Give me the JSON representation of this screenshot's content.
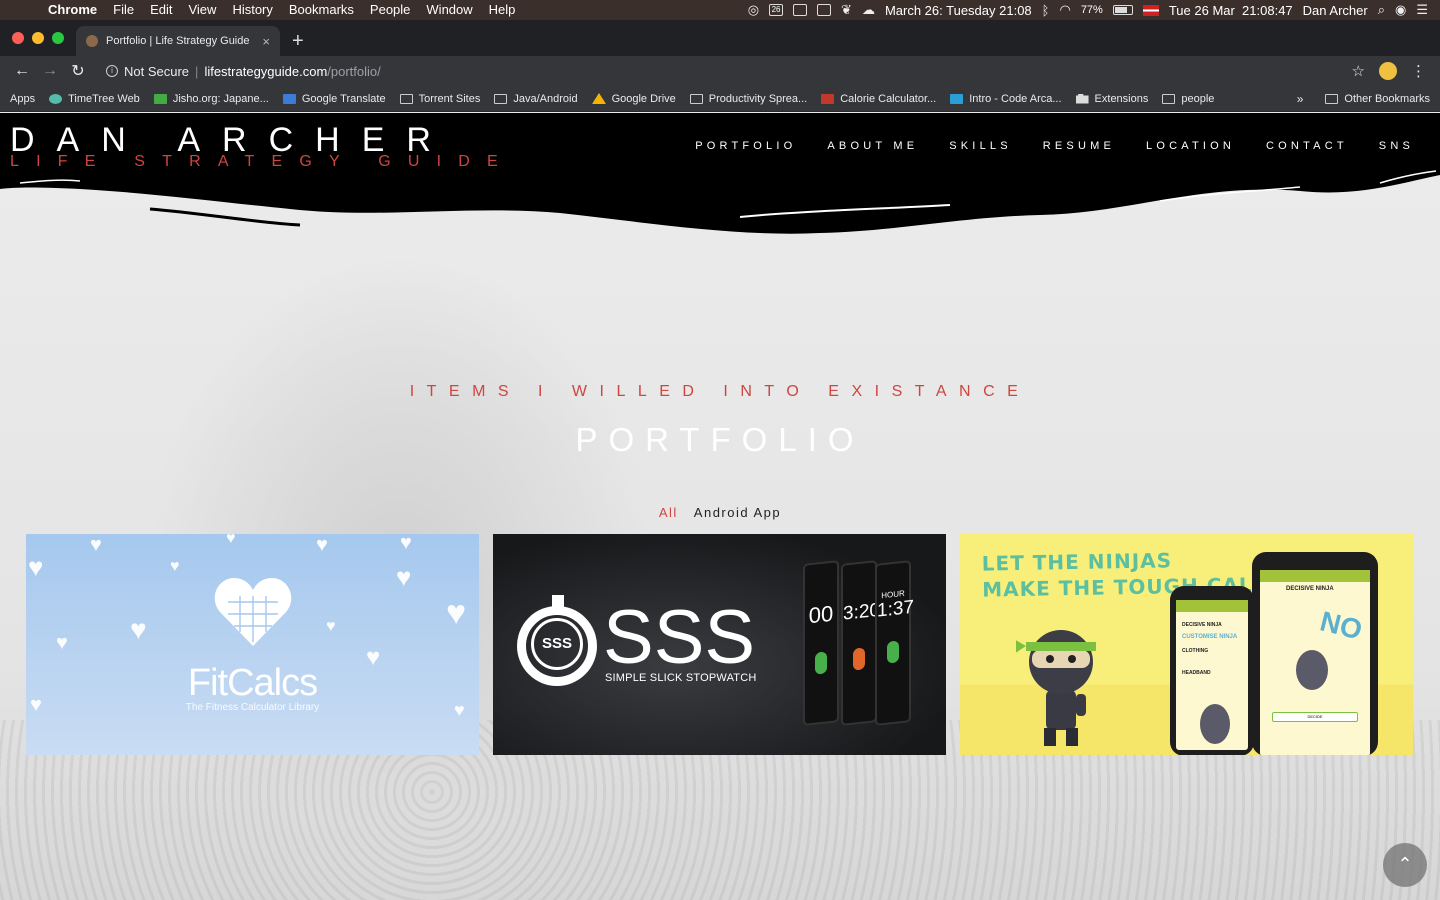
{
  "menubar": {
    "app": "Chrome",
    "items": [
      "File",
      "Edit",
      "View",
      "History",
      "Bookmarks",
      "People",
      "Window",
      "Help"
    ],
    "calendar_day": "26",
    "date_short": "March 26: Tuesday 21:08",
    "battery": "77%",
    "clock": "Tue 26 Mar  21:08:47",
    "user": "Dan Archer"
  },
  "tab": {
    "title": "Portfolio | Life Strategy Guide",
    "close": "×",
    "new_tab": "+"
  },
  "toolbar": {
    "security": "Not Secure",
    "host": "lifestrategyguide.com",
    "path": "/portfolio/"
  },
  "bookmarks": [
    {
      "label": "Apps",
      "icon": "apps-grid-icon"
    },
    {
      "label": "TimeTree Web",
      "icon": "timetree-icon"
    },
    {
      "label": "Jisho.org: Japane...",
      "icon": "jisho-icon"
    },
    {
      "label": "Google Translate",
      "icon": "translate-icon"
    },
    {
      "label": "Torrent Sites",
      "icon": "folder-icon"
    },
    {
      "label": "Java/Android",
      "icon": "folder-icon"
    },
    {
      "label": "Google Drive",
      "icon": "drive-icon"
    },
    {
      "label": "Productivity Sprea...",
      "icon": "folder-icon"
    },
    {
      "label": "Calorie Calculator...",
      "icon": "calorie-icon"
    },
    {
      "label": "Intro - Code Arca...",
      "icon": "codearcade-icon"
    },
    {
      "label": "Extensions",
      "icon": "puzzle-icon"
    },
    {
      "label": "people",
      "icon": "folder-icon"
    }
  ],
  "bookmarks_more": "»",
  "other_bookmarks": "Other Bookmarks",
  "site": {
    "logo_name": "DAN ARCHER",
    "logo_sub": "LIFE STRATEGY GUIDE",
    "nav": [
      "PORTFOLIO",
      "ABOUT ME",
      "SKILLS",
      "RESUME",
      "LOCATION",
      "CONTACT",
      "SNS"
    ],
    "eyebrow": "ITEMS I WILLED INTO EXISTANCE",
    "title": "PORTFOLIO",
    "filters": {
      "all": "All",
      "android": "Android App"
    },
    "cards": {
      "fitcalcs": {
        "title": "FitCalcs",
        "subtitle": "The Fitness Calculator Library"
      },
      "sss": {
        "logo": "SSS",
        "title": "SSS",
        "subtitle": "SIMPLE SLICK STOPWATCH",
        "phones": [
          "00",
          "3:20",
          "1:37"
        ],
        "phone_label": "HOUR"
      },
      "ninja": {
        "headline_1": "LET THE NINJAS",
        "headline_2": "MAKE THE TOUGH CALLS",
        "app_name": "DECISIVE NINJA",
        "answer": "NO",
        "menu_1": "CUSTOMISE NINJA",
        "menu_2": "CLOTHING",
        "menu_3": "HEADBAND",
        "button": "DECIDE"
      }
    },
    "scroll_top": "⌃"
  },
  "colors": {
    "accent_red": "#d0453f",
    "header_black": "#000000",
    "fitcalcs_blue": "#a5c8ee",
    "ninja_yellow": "#f8ef7a"
  }
}
